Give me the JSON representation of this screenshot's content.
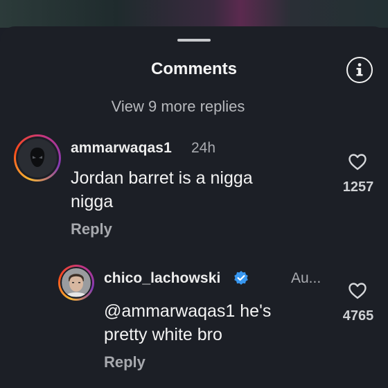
{
  "sheet": {
    "title": "Comments",
    "view_more": "View 9 more replies"
  },
  "comments": [
    {
      "username": "ammarwaqas1",
      "time": "24h",
      "text_line1": "Jordan barret is a nigga",
      "text_line2": "nigga",
      "reply_label": "Reply",
      "likes": "1257",
      "avatar_icon": "masked-figure-avatar"
    }
  ],
  "replies": [
    {
      "username": "chico_lachowski",
      "verified": true,
      "time": "Au...",
      "text_line1": "@ammarwaqas1 he's",
      "text_line2": "pretty white bro",
      "reply_label": "Reply",
      "likes": "4765",
      "avatar_icon": "man-portrait-avatar"
    }
  ],
  "icons": {
    "info": "info-icon",
    "heart": "heart-icon",
    "verified": "verified-badge-icon"
  },
  "colors": {
    "background": "#1c1f26",
    "verified_blue": "#3897f0",
    "story_ring": [
      "#f7b733",
      "#fc4a1a",
      "#c13584",
      "#833ab4"
    ]
  }
}
